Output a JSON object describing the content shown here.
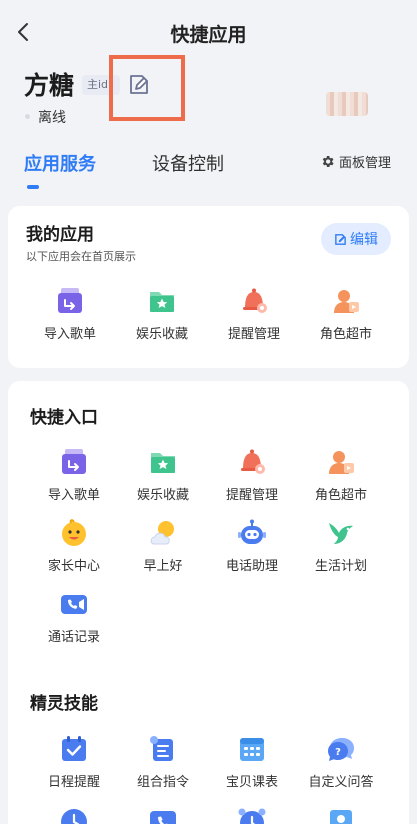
{
  "header": {
    "title": "快捷应用"
  },
  "device": {
    "name": "方糖",
    "role_badge": "主id",
    "status": "离线"
  },
  "tabs": [
    {
      "label": "应用服务",
      "active": true
    },
    {
      "label": "设备控制",
      "active": false
    }
  ],
  "panel_manage": {
    "label": "面板管理"
  },
  "my_apps": {
    "title": "我的应用",
    "subtitle": "以下应用会在首页展示",
    "edit_label": "编辑",
    "items": [
      {
        "label": "导入歌单",
        "icon": "import-playlist-icon"
      },
      {
        "label": "娱乐收藏",
        "icon": "favorites-folder-icon"
      },
      {
        "label": "提醒管理",
        "icon": "reminder-bell-icon"
      },
      {
        "label": "角色超市",
        "icon": "role-market-icon"
      }
    ]
  },
  "quick_entry": {
    "title": "快捷入口",
    "items": [
      {
        "label": "导入歌单",
        "icon": "import-playlist-icon"
      },
      {
        "label": "娱乐收藏",
        "icon": "favorites-folder-icon"
      },
      {
        "label": "提醒管理",
        "icon": "reminder-bell-icon"
      },
      {
        "label": "角色超市",
        "icon": "role-market-icon"
      },
      {
        "label": "家长中心",
        "icon": "parent-center-icon"
      },
      {
        "label": "早上好",
        "icon": "sun-cloud-icon"
      },
      {
        "label": "电话助理",
        "icon": "robot-icon"
      },
      {
        "label": "生活计划",
        "icon": "bird-icon"
      },
      {
        "label": "通话记录",
        "icon": "video-call-icon"
      }
    ]
  },
  "skills": {
    "title": "精灵技能",
    "items": [
      {
        "label": "日程提醒",
        "icon": "calendar-check-icon"
      },
      {
        "label": "组合指令",
        "icon": "combo-command-icon"
      },
      {
        "label": "宝贝课表",
        "icon": "timetable-icon"
      },
      {
        "label": "自定义问答",
        "icon": "custom-qa-icon"
      }
    ]
  },
  "colors": {
    "accent": "#2f7cf6",
    "highlight": "#ef6c4a",
    "background": "#f2f3f7"
  }
}
